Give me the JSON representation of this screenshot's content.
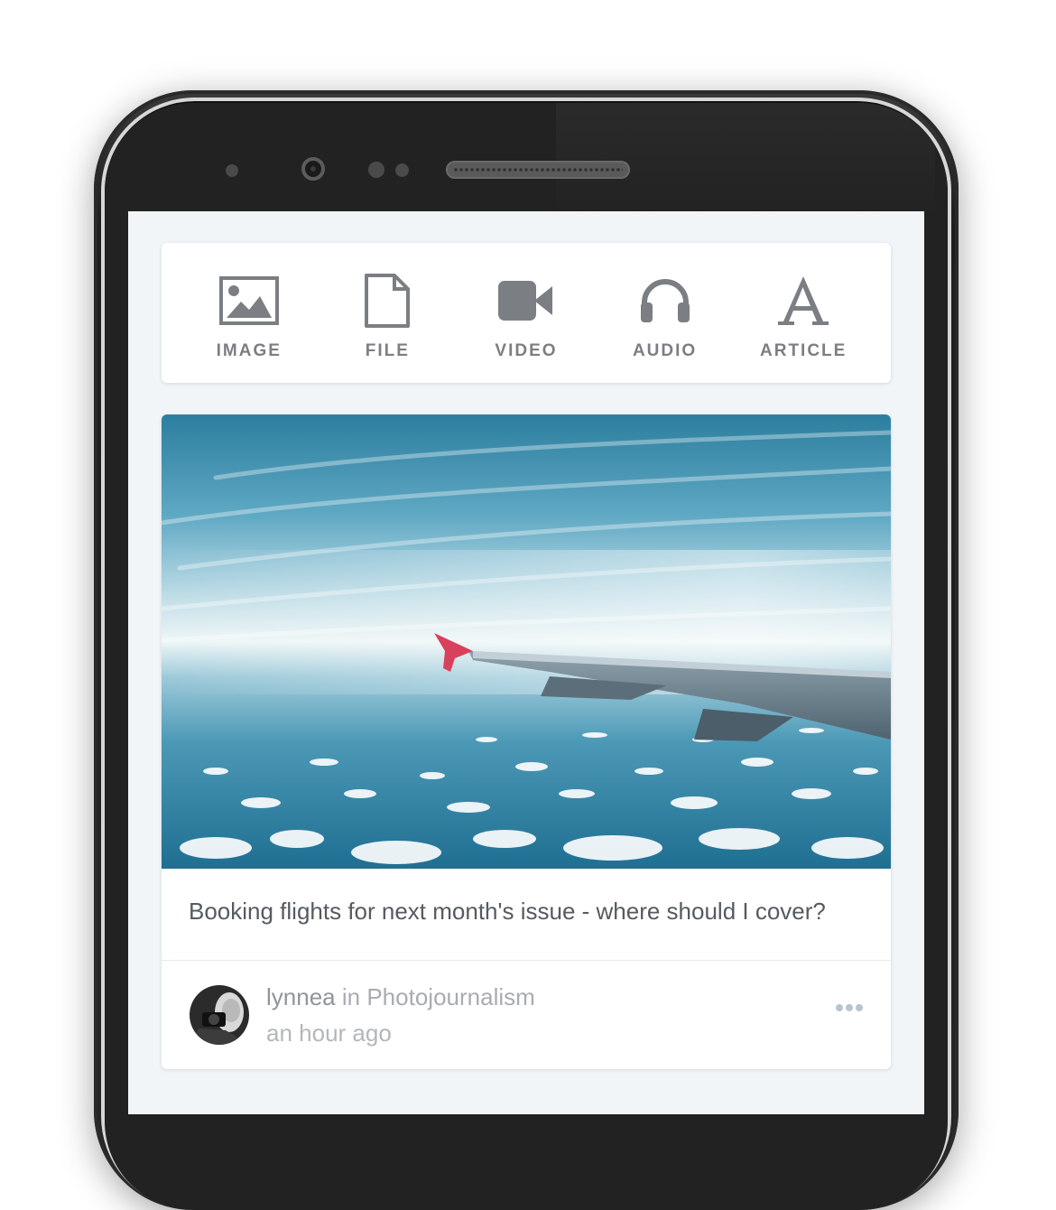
{
  "composer": {
    "items": [
      {
        "label": "IMAGE",
        "icon": "image-icon"
      },
      {
        "label": "FILE",
        "icon": "file-icon"
      },
      {
        "label": "VIDEO",
        "icon": "video-camera-icon"
      },
      {
        "label": "AUDIO",
        "icon": "headphones-icon"
      },
      {
        "label": "ARTICLE",
        "icon": "article-letter-a-icon"
      }
    ],
    "icon_color": "#7b7e83"
  },
  "post": {
    "image": "airplane-wing-over-clouds-photo",
    "caption": "Booking flights for next month's issue - where should I cover?",
    "author": "lynnea",
    "in_word": "in",
    "community": "Photojournalism",
    "timestamp": "an hour ago",
    "more_icon": "more-dots-icon"
  },
  "colors": {
    "screen_background": "#f1f5f8",
    "text_secondary": "#a8acb1",
    "wingtip_accent": "#d9405e"
  }
}
